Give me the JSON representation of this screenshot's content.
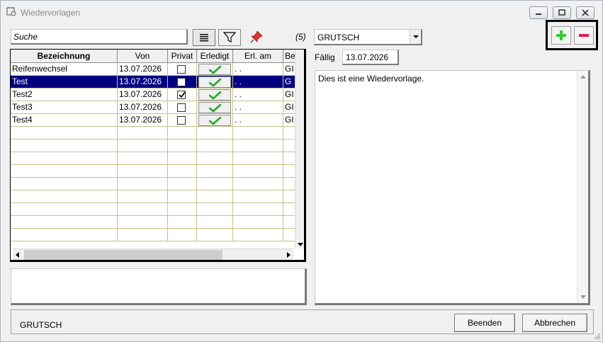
{
  "window": {
    "title": "Wiedervorlagen"
  },
  "toolbar": {
    "search_value": "Suche",
    "count": "(5)",
    "user_selected": "GRUTSCH"
  },
  "grid": {
    "columns": [
      "Bezeichnung",
      "Von",
      "Privat",
      "Erledigt",
      "Erl. am",
      "Be"
    ],
    "rows": [
      {
        "bezeichnung": "Reifenwechsel",
        "von": "13.07.2026",
        "privat": false,
        "erl_am": ". .",
        "be": "GI",
        "selected": false
      },
      {
        "bezeichnung": "Test",
        "von": "13.07.2026",
        "privat": false,
        "erl_am": ". .",
        "be": "G",
        "selected": true
      },
      {
        "bezeichnung": "Test2",
        "von": "13.07.2026",
        "privat": true,
        "erl_am": ". .",
        "be": "GI",
        "selected": false
      },
      {
        "bezeichnung": "Test3",
        "von": "13.07.2026",
        "privat": false,
        "erl_am": ". .",
        "be": "GI",
        "selected": false
      },
      {
        "bezeichnung": "Test4",
        "von": "13.07.2026",
        "privat": false,
        "erl_am": ". .",
        "be": "GI",
        "selected": false
      }
    ]
  },
  "detail": {
    "faellig_label": "Fällig",
    "faellig_value": "13.07.2026",
    "memo_text": "Dies ist eine Wiedervorlage."
  },
  "status": {
    "user": "GRUTSCH",
    "beenden_label": "Beenden",
    "abbrechen_label": "Abbrechen"
  },
  "colors": {
    "selection": "#000080",
    "add_green": "#33cc33",
    "remove_red": "#e0204a",
    "pin_red": "#e03030"
  }
}
